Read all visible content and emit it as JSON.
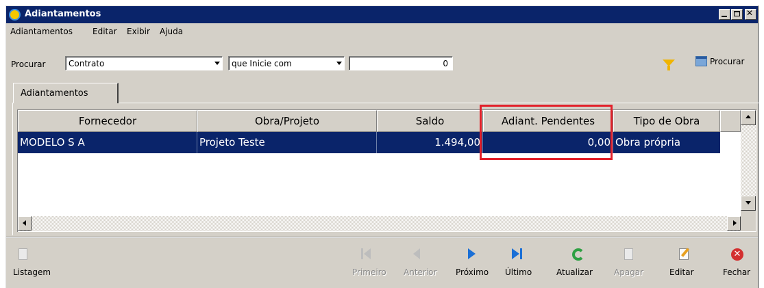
{
  "window": {
    "title": "Adiantamentos"
  },
  "menu": [
    "Adiantamentos",
    "Editar",
    "Exibir",
    "Ajuda"
  ],
  "search": {
    "label": "Procurar",
    "field": "Contrato",
    "operator": "que Inicie com",
    "value": "0",
    "button_label": "Procurar"
  },
  "tab": {
    "label": "Adiantamentos"
  },
  "grid": {
    "columns": [
      "Fornecedor",
      "Obra/Projeto",
      "Saldo",
      "Adiant. Pendentes",
      "Tipo de Obra"
    ],
    "rows": [
      [
        "MODELO S A",
        "Projeto Teste",
        "1.494,00",
        "0,00",
        "Obra própria"
      ]
    ]
  },
  "toolbar": {
    "listagem": "Listagem",
    "primeiro": "Primeiro",
    "anterior": "Anterior",
    "proximo": "Próximo",
    "ultimo": "Último",
    "atualizar": "Atualizar",
    "apagar": "Apagar",
    "editar": "Editar",
    "fechar": "Fechar"
  },
  "colors": {
    "title_bar": "#0a246a",
    "selection": "#0a246a",
    "highlight_box": "#e2202a",
    "face": "#d4d0c8"
  }
}
